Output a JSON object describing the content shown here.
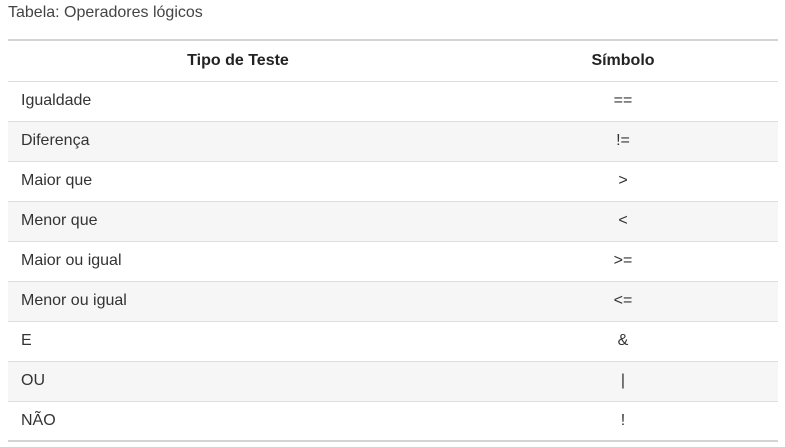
{
  "caption": "Tabela: Operadores lógicos",
  "table": {
    "headers": [
      "Tipo de Teste",
      "Símbolo"
    ],
    "rows": [
      [
        "Igualdade",
        "=="
      ],
      [
        "Diferença",
        "!="
      ],
      [
        "Maior que",
        ">"
      ],
      [
        "Menor que",
        "<"
      ],
      [
        "Maior ou igual",
        ">="
      ],
      [
        "Menor ou igual",
        "<="
      ],
      [
        "E",
        "&"
      ],
      [
        "OU",
        "|"
      ],
      [
        "NÃO",
        "!"
      ]
    ]
  }
}
